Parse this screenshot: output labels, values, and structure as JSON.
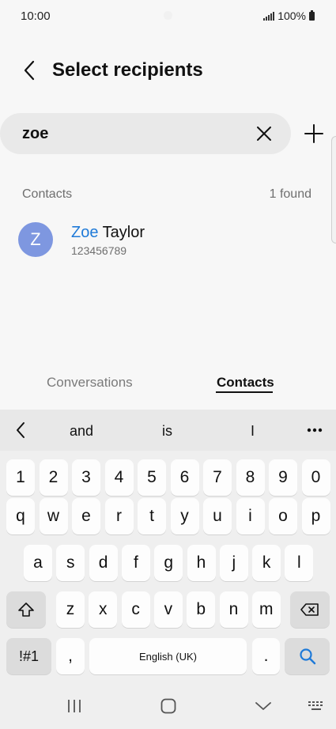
{
  "status_bar": {
    "time": "10:00",
    "battery": "100%"
  },
  "header": {
    "title": "Select recipients"
  },
  "search": {
    "value": "zoe"
  },
  "results": {
    "section_label": "Contacts",
    "found_count": "1 found",
    "contacts": [
      {
        "initial": "Z",
        "name_match": "Zoe",
        "name_rest": " Taylor",
        "number": "123456789"
      }
    ]
  },
  "tabs": {
    "conversations": "Conversations",
    "contacts": "Contacts",
    "active": "Contacts"
  },
  "keyboard": {
    "suggestions": [
      "and",
      "is",
      "I"
    ],
    "row_numbers": [
      "1",
      "2",
      "3",
      "4",
      "5",
      "6",
      "7",
      "8",
      "9",
      "0"
    ],
    "row1": [
      "q",
      "w",
      "e",
      "r",
      "t",
      "y",
      "u",
      "i",
      "o",
      "p"
    ],
    "row2": [
      "a",
      "s",
      "d",
      "f",
      "g",
      "h",
      "j",
      "k",
      "l"
    ],
    "row3": [
      "z",
      "x",
      "c",
      "v",
      "b",
      "n",
      "m"
    ],
    "symbols_key": "!#1",
    "comma_key": ",",
    "space_label": "English (UK)",
    "period_key": "."
  },
  "colors": {
    "accent": "#1f7ad8",
    "avatar": "#7e97e0",
    "search_key": "#1f7ad8"
  }
}
